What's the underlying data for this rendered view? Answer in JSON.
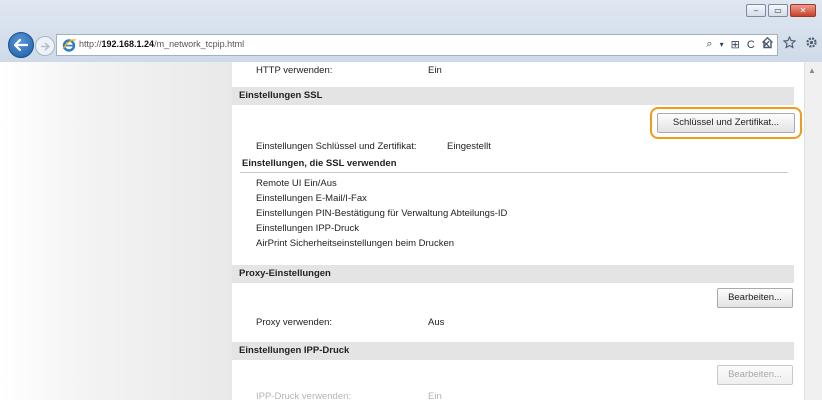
{
  "browser": {
    "url_prefix": "http://",
    "url_host": "192.168.1.24",
    "url_path": "/m_network_tcpip.html",
    "addr_tools": [
      "⌕",
      "▾",
      "⊞",
      "C",
      "✕"
    ],
    "window_controls": [
      "–",
      "▭",
      "✕"
    ]
  },
  "content": {
    "http_label": "HTTP verwenden:",
    "http_value": "Ein",
    "ssl_section": {
      "title": "Einstellungen SSL",
      "key_cert_button": "Schlüssel und Zertifikat...",
      "key_cert_label": "Einstellungen Schlüssel und Zertifikat:",
      "key_cert_value": "Eingestellt",
      "using_ssl_title": "Einstellungen, die SSL verwenden",
      "using_ssl_items": [
        "Remote UI Ein/Aus",
        "Einstellungen E-Mail/I-Fax",
        "Einstellungen PIN-Bestätigung für Verwaltung Abteilungs-ID",
        "Einstellungen IPP-Druck",
        "AirPrint Sicherheitseinstellungen beim Drucken"
      ]
    },
    "proxy_section": {
      "title": "Proxy-Einstellungen",
      "edit_button": "Bearbeiten...",
      "use_label": "Proxy verwenden:",
      "use_value": "Aus"
    },
    "ipp_section": {
      "title": "Einstellungen IPP-Druck",
      "edit_button": "Bearbeiten...",
      "use_label": "IPP-Druck verwenden:",
      "use_value": "Ein"
    }
  },
  "colors": {
    "highlight": "#f19a1b",
    "section_header_bg": "#e4e4e4"
  }
}
